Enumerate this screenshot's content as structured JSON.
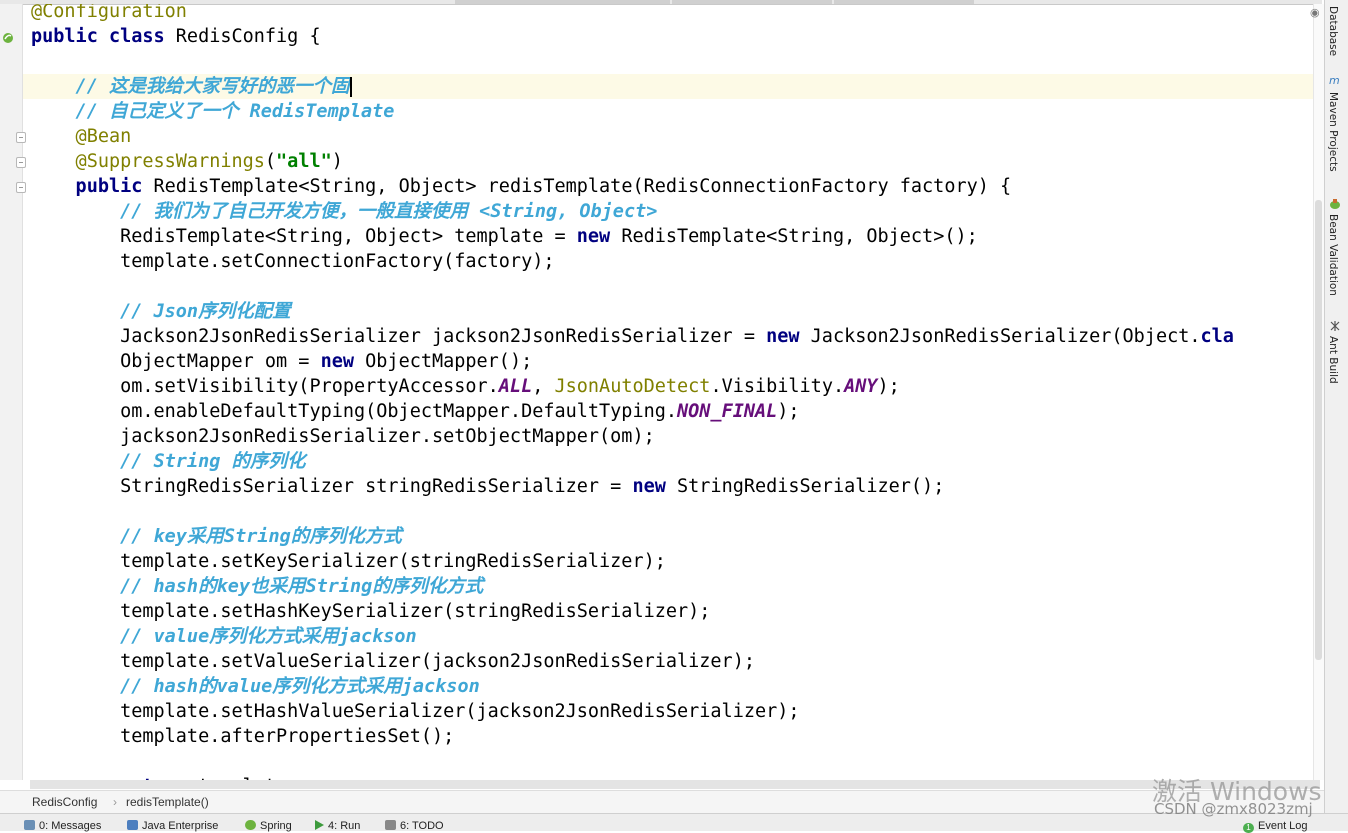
{
  "code_lines": [
    {
      "tokens": [
        {
          "t": "@Configuration",
          "c": "ann"
        }
      ]
    },
    {
      "tokens": [
        {
          "t": "public class ",
          "c": "kw"
        },
        {
          "t": "RedisConfig {",
          "c": ""
        }
      ]
    },
    {
      "tokens": []
    },
    {
      "tokens": [
        {
          "t": "    // 这是我给大家写好的恶一个固",
          "c": "cm"
        }
      ],
      "caret": true
    },
    {
      "tokens": [
        {
          "t": "    // 自己定义了一个 RedisTemplate",
          "c": "cm"
        }
      ]
    },
    {
      "tokens": [
        {
          "t": "    @Bean",
          "c": "ann"
        }
      ]
    },
    {
      "tokens": [
        {
          "t": "    @SuppressWarnings",
          "c": "ann"
        },
        {
          "t": "(",
          "c": ""
        },
        {
          "t": "\"all\"",
          "c": "st"
        },
        {
          "t": ")",
          "c": ""
        }
      ]
    },
    {
      "tokens": [
        {
          "t": "    public ",
          "c": "kw"
        },
        {
          "t": "RedisTemplate<String, Object> redisTemplate(RedisConnectionFactory factory) {",
          "c": ""
        }
      ]
    },
    {
      "tokens": [
        {
          "t": "        // 我们为了自己开发方便，一般直接使用 <String, Object>",
          "c": "cm"
        }
      ]
    },
    {
      "tokens": [
        {
          "t": "        RedisTemplate<String, Object> template = ",
          "c": ""
        },
        {
          "t": "new ",
          "c": "kw"
        },
        {
          "t": "RedisTemplate<String, Object>();",
          "c": ""
        }
      ]
    },
    {
      "tokens": [
        {
          "t": "        template.setConnectionFactory(factory);",
          "c": ""
        }
      ]
    },
    {
      "tokens": []
    },
    {
      "tokens": [
        {
          "t": "        // Json序列化配置",
          "c": "cm"
        }
      ]
    },
    {
      "tokens": [
        {
          "t": "        Jackson2JsonRedisSerializer jackson2JsonRedisSerializer = ",
          "c": ""
        },
        {
          "t": "new ",
          "c": "kw"
        },
        {
          "t": "Jackson2JsonRedisSerializer(Object.",
          "c": ""
        },
        {
          "t": "cla",
          "c": "kw"
        }
      ]
    },
    {
      "tokens": [
        {
          "t": "        ObjectMapper om = ",
          "c": ""
        },
        {
          "t": "new ",
          "c": "kw"
        },
        {
          "t": "ObjectMapper();",
          "c": ""
        }
      ]
    },
    {
      "tokens": [
        {
          "t": "        om.setVisibility(PropertyAccessor.",
          "c": ""
        },
        {
          "t": "ALL",
          "c": "fld"
        },
        {
          "t": ", ",
          "c": ""
        },
        {
          "t": "JsonAutoDetect",
          "c": "cls"
        },
        {
          "t": ".Visibility.",
          "c": ""
        },
        {
          "t": "ANY",
          "c": "fld"
        },
        {
          "t": ");",
          "c": ""
        }
      ]
    },
    {
      "tokens": [
        {
          "t": "        om.enableDefaultTyping(ObjectMapper.DefaultTyping.",
          "c": ""
        },
        {
          "t": "NON_FINAL",
          "c": "fld"
        },
        {
          "t": ");",
          "c": ""
        }
      ]
    },
    {
      "tokens": [
        {
          "t": "        jackson2JsonRedisSerializer.setObjectMapper(om);",
          "c": ""
        }
      ]
    },
    {
      "tokens": [
        {
          "t": "        // String 的序列化",
          "c": "cm"
        }
      ]
    },
    {
      "tokens": [
        {
          "t": "        StringRedisSerializer stringRedisSerializer = ",
          "c": ""
        },
        {
          "t": "new ",
          "c": "kw"
        },
        {
          "t": "StringRedisSerializer();",
          "c": ""
        }
      ]
    },
    {
      "tokens": []
    },
    {
      "tokens": [
        {
          "t": "        // key采用String的序列化方式",
          "c": "cm"
        }
      ]
    },
    {
      "tokens": [
        {
          "t": "        template.setKeySerializer(stringRedisSerializer);",
          "c": ""
        }
      ]
    },
    {
      "tokens": [
        {
          "t": "        // hash的key也采用String的序列化方式",
          "c": "cm"
        }
      ]
    },
    {
      "tokens": [
        {
          "t": "        template.setHashKeySerializer(stringRedisSerializer);",
          "c": ""
        }
      ]
    },
    {
      "tokens": [
        {
          "t": "        // value序列化方式采用jackson",
          "c": "cm"
        }
      ]
    },
    {
      "tokens": [
        {
          "t": "        template.setValueSerializer(jackson2JsonRedisSerializer);",
          "c": ""
        }
      ]
    },
    {
      "tokens": [
        {
          "t": "        // hash的value序列化方式采用jackson",
          "c": "cm"
        }
      ]
    },
    {
      "tokens": [
        {
          "t": "        template.setHashValueSerializer(jackson2JsonRedisSerializer);",
          "c": ""
        }
      ]
    },
    {
      "tokens": [
        {
          "t": "        template.afterPropertiesSet();",
          "c": ""
        }
      ]
    },
    {
      "tokens": []
    },
    {
      "tokens": [
        {
          "t": "        return ",
          "c": "kw"
        },
        {
          "t": "template;",
          "c": ""
        }
      ]
    }
  ],
  "breadcrumb": {
    "item1": "RedisConfig",
    "separator": "›",
    "item2": "redisTemplate()"
  },
  "right_tools": [
    {
      "label": "Database",
      "icon": "database-icon"
    },
    {
      "label": "Maven Projects",
      "icon": "maven-icon",
      "glyph": "m"
    },
    {
      "label": "Bean Validation",
      "icon": "bean-validation-icon"
    },
    {
      "label": "Ant Build",
      "icon": "ant-build-icon"
    }
  ],
  "bottom_tools": [
    {
      "label": "0: Messages",
      "icon": "messages-icon",
      "color": "#6a8fb5"
    },
    {
      "label": "Java Enterprise",
      "icon": "java-enterprise-icon",
      "color": "#4d7fbf"
    },
    {
      "label": "Spring",
      "icon": "spring-icon",
      "color": "#6db33f"
    },
    {
      "label": "4: Run",
      "icon": "run-icon",
      "color": "#3c9a3c"
    },
    {
      "label": "6: TODO",
      "icon": "todo-icon",
      "color": "#888888"
    },
    {
      "label": "Event Log",
      "icon": "event-log-icon",
      "color": "#4caf50",
      "badge": "1"
    }
  ],
  "watermark": {
    "activate": "激活 Windows",
    "csdn": "CSDN @zmx8023zmj"
  },
  "colors": {
    "keyword": "#000080",
    "annotation": "#808000",
    "comment": "#3fa7d6",
    "string": "#008000",
    "static_field": "#660e7a",
    "current_line": "#fdfae6"
  }
}
